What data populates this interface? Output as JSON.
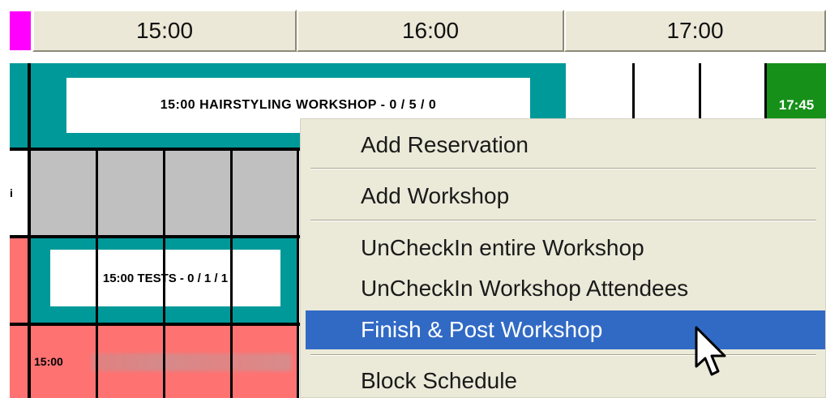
{
  "header": {
    "times": [
      "15:00",
      "16:00",
      "17:00"
    ]
  },
  "schedule": {
    "workshop_block": "15:00 HAIRSTYLING WORKSHOP - 0 / 5 / 0",
    "green_slot": "17:45",
    "tests_block": "15:00 TESTS - 0 / 1 / 1",
    "salmon_time": "15:00",
    "row_edge_label": "i"
  },
  "context_menu": {
    "items": [
      "Add Reservation",
      "Add Workshop",
      "UnCheckIn entire Workshop",
      "UnCheckIn Workshop Attendees",
      "Finish & Post Workshop",
      "Block Schedule"
    ],
    "highlighted_index": 4
  },
  "colors": {
    "teal": "#009999",
    "salmon": "#ff7272",
    "gray": "#c0c0c0",
    "green": "#169018",
    "highlight": "#316ac5",
    "magenta": "#ff00ff"
  }
}
